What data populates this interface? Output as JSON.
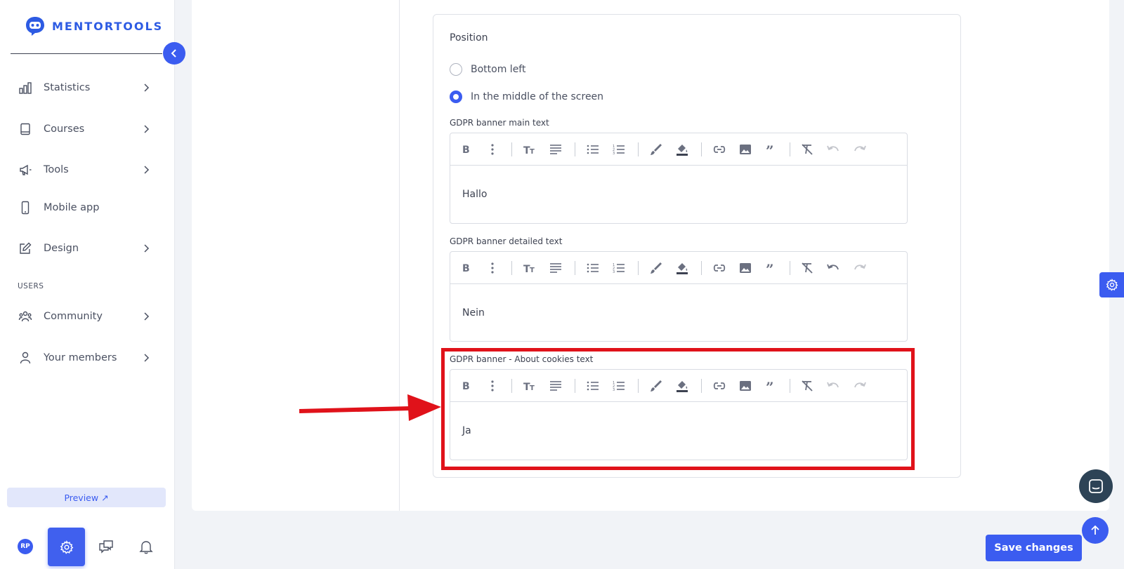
{
  "brand": {
    "name": "MENTORTOOLS",
    "color": "#2d5be3"
  },
  "accent": "#3b5cf0",
  "sidebar": {
    "items": [
      {
        "label": "Statistics",
        "icon": "bar-chart-icon",
        "has_chevron": true
      },
      {
        "label": "Courses",
        "icon": "book-icon",
        "has_chevron": true
      },
      {
        "label": "Tools",
        "icon": "megaphone-icon",
        "has_chevron": true
      },
      {
        "label": "Mobile app",
        "icon": "mobile-icon",
        "has_chevron": false
      },
      {
        "label": "Design",
        "icon": "pencil-icon",
        "has_chevron": true
      }
    ],
    "section_users": "USERS",
    "user_items": [
      {
        "label": "Community",
        "icon": "people-icon",
        "has_chevron": true
      },
      {
        "label": "Your members",
        "icon": "user-icon",
        "has_chevron": true
      }
    ],
    "preview_label": "Preview ↗",
    "avatar_initials": "RP"
  },
  "settings": {
    "position_title": "Position",
    "position_options": [
      {
        "label": "Bottom left",
        "checked": false
      },
      {
        "label": "In the middle of the screen",
        "checked": true
      }
    ],
    "editors": [
      {
        "label": "GDPR banner main text",
        "value": "Hallo"
      },
      {
        "label": "GDPR banner detailed text",
        "value": "Nein"
      },
      {
        "label": "GDPR banner - About cookies text",
        "value": "Ja"
      }
    ]
  },
  "actions": {
    "save_label": "Save changes"
  },
  "annotation_color": "#e0121a"
}
